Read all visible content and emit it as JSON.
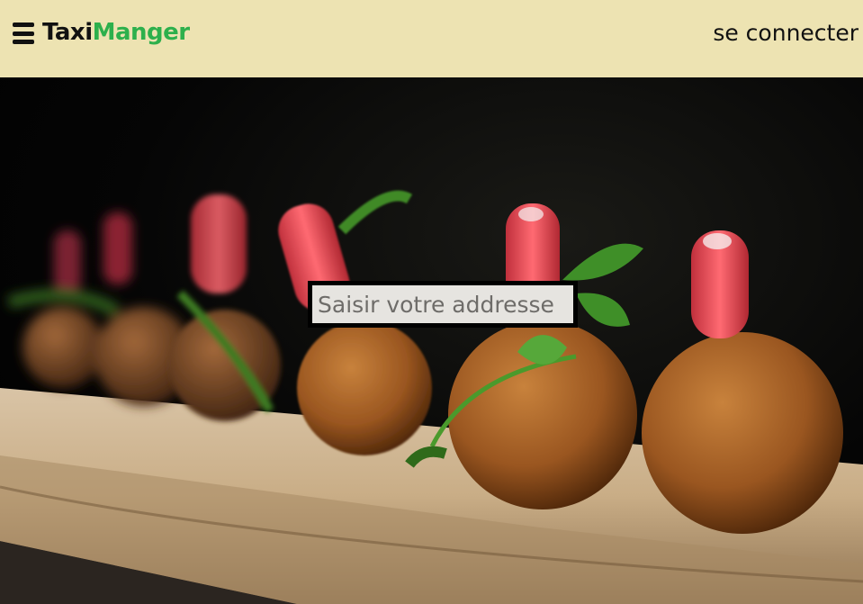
{
  "header": {
    "brand_part1": "Taxi",
    "brand_part2": "Manger",
    "login_label": "se connecter",
    "menu_icon": "hamburger-menu-icon"
  },
  "search": {
    "placeholder": "Saisir votre addresse",
    "value": ""
  },
  "hero": {
    "image": "food-croquettes-photo"
  },
  "colors": {
    "header_bg": "#ede3b2",
    "brand_accent": "#2db04c",
    "text_dark": "#111111"
  }
}
